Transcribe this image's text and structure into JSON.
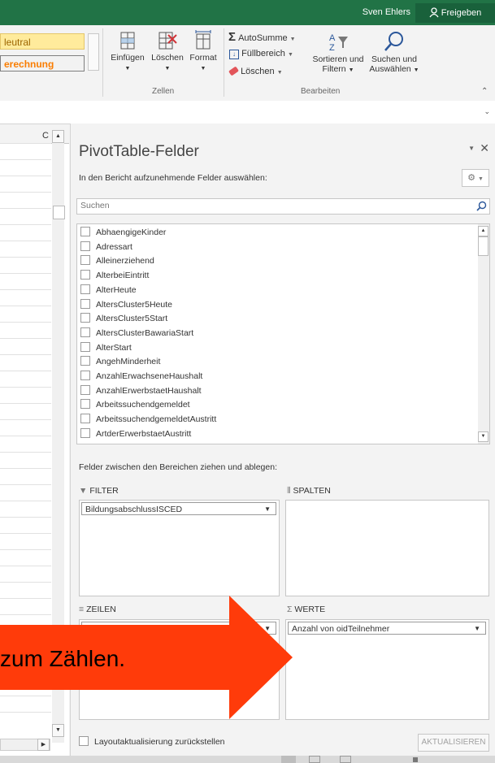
{
  "titlebar": {
    "user": "Sven Ehlers",
    "share_label": "Freigeben"
  },
  "ribbon": {
    "styles": {
      "neutral": "leutral",
      "calc": "erechnung"
    },
    "cells_group": {
      "label": "Zellen",
      "insert": "Einfügen",
      "delete": "Löschen",
      "format": "Format"
    },
    "edit_group": {
      "label": "Bearbeiten",
      "autosum": "AutoSumme",
      "fill": "Füllbereich",
      "clear": "Löschen",
      "sort_l1": "Sortieren und",
      "sort_l2": "Filtern",
      "find_l1": "Suchen und",
      "find_l2": "Auswählen"
    }
  },
  "sheet": {
    "column_letter": "C"
  },
  "pivot": {
    "title": "PivotTable-Felder",
    "subtitle": "In den Bericht aufzunehmende Felder auswählen:",
    "search_placeholder": "Suchen",
    "fields": [
      "AbhaengigeKinder",
      "Adressart",
      "Alleinerziehend",
      "AlterbeiEintritt",
      "AlterHeute",
      "AltersCluster5Heute",
      "AltersCluster5Start",
      "AltersClusterBawariaStart",
      "AlterStart",
      "AngehMinderheit",
      "AnzahlErwachseneHaushalt",
      "AnzahlErwerbstaetHaushalt",
      "Arbeitssuchendgemeldet",
      "ArbeitssuchendgemeldetAustritt",
      "ArtderErwerbstaetAustritt"
    ],
    "drag_hint": "Felder zwischen den Bereichen ziehen und ablegen:",
    "areas": {
      "filter": {
        "label": "FILTER",
        "item": "BildungsabschlussISCED"
      },
      "columns": {
        "label": "SPALTEN"
      },
      "rows": {
        "label": "ZEILEN"
      },
      "values": {
        "label": "WERTE",
        "item": "Anzahl von oidTeilnehmer"
      }
    },
    "defer_label": "Layoutaktualisierung zurückstellen",
    "update_label": "AKTUALISIEREN"
  },
  "callout": {
    "text": "zum Zählen.",
    "color": "#ff3b0a"
  },
  "colors": {
    "excel_green": "#217346",
    "accent_blue": "#2b579a"
  }
}
